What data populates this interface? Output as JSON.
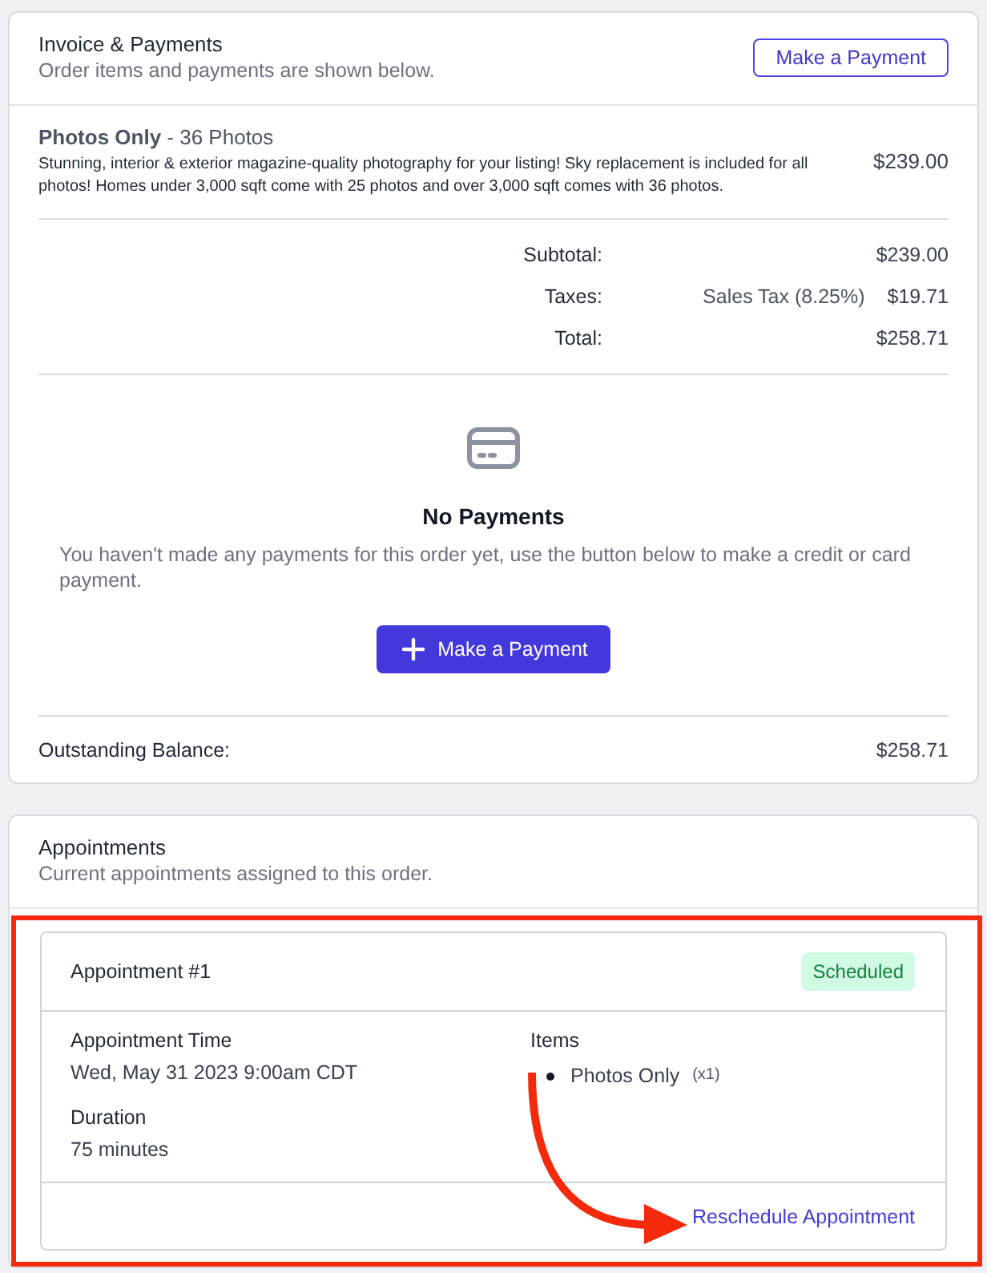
{
  "invoice": {
    "title": "Invoice & Payments",
    "subtitle": "Order items and payments are shown below.",
    "header_button": "Make a Payment",
    "items": [
      {
        "title": "**Photos Only** - 36 Photos",
        "description": "Stunning, interior & exterior magazine-quality photography for your listing! Sky replacement is included for all photos! Homes under 3,000 sqft come with 25 photos and over 3,000 sqft comes with 36 photos.",
        "price": "$239.00"
      }
    ],
    "totals": [
      {
        "label": "Subtotal:",
        "value": "$239.00"
      },
      {
        "label": "Taxes:",
        "detail": "Sales Tax (8.25%)",
        "value": "$19.71"
      },
      {
        "label": "Total:",
        "value": "$258.71"
      }
    ],
    "payments_empty": {
      "title": "No Payments",
      "message": "You haven't made any payments for this order yet, use the button below to make a credit or card payment.",
      "button": "Make a Payment"
    },
    "balance": {
      "label": "Outstanding Balance:",
      "value": "$258.71"
    }
  },
  "appointments": {
    "title": "Appointments",
    "subtitle": "Current appointments assigned to this order.",
    "list": [
      {
        "title": "Appointment #1",
        "status": {
          "label": "Scheduled",
          "kind": "scheduled"
        },
        "fields": [
          {
            "label": "Appointment Time",
            "value": "Wed, May 31 2023 9:00am CDT"
          },
          {
            "label": "Duration",
            "value": "75 minutes"
          }
        ],
        "items_label": "Items",
        "items": [
          {
            "name": "Photos Only",
            "quantity": "(x1)"
          }
        ],
        "action": "Reschedule Appointment",
        "highlighted": true
      }
    ]
  }
}
